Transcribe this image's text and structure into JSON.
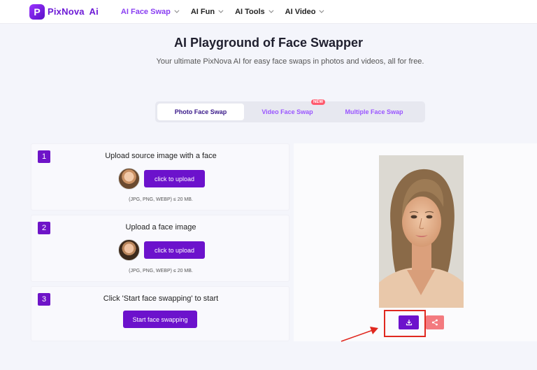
{
  "brand": {
    "name": "PixNova",
    "suffix": "Ai",
    "mark": "P"
  },
  "nav": [
    {
      "label": "AI Face Swap",
      "active": true
    },
    {
      "label": "AI Fun",
      "active": false
    },
    {
      "label": "AI Tools",
      "active": false
    },
    {
      "label": "AI Video",
      "active": false
    }
  ],
  "hero": {
    "title": "AI Playground of Face Swapper",
    "subtitle": "Your ultimate PixNova AI for easy face swaps in photos and videos, all for free."
  },
  "tabs": [
    {
      "label": "Photo Face Swap",
      "active": true
    },
    {
      "label": "Video Face Swap",
      "badge": "NEW"
    },
    {
      "label": "Multiple Face Swap"
    }
  ],
  "steps": [
    {
      "num": "1",
      "title": "Upload source image with a face",
      "button": "click to upload",
      "hint": "(JPG, PNG, WEBP) ≤ 20 MB."
    },
    {
      "num": "2",
      "title": "Upload a face image",
      "button": "click to upload",
      "hint": "(JPG, PNG, WEBP) ≤ 20 MB."
    },
    {
      "num": "3",
      "title": "Click 'Start face swapping' to start",
      "button": "Start face swapping"
    }
  ],
  "result": {
    "download_icon": "download-icon",
    "share_icon": "share-icon",
    "highlight_color": "#e0281f"
  },
  "colors": {
    "accent": "#6c12cc",
    "tab_text": "#9a55ff",
    "share": "#f37a7f"
  }
}
